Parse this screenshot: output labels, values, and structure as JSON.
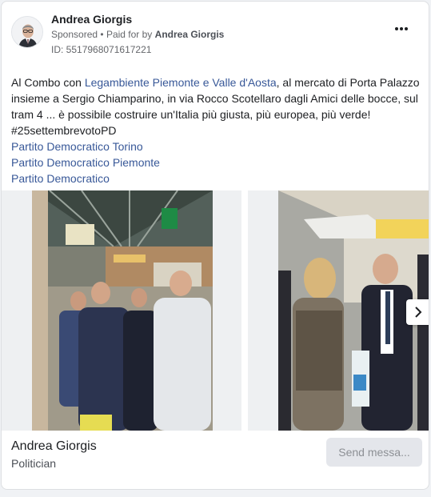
{
  "ad": {
    "advertiser_name": "Andrea Giorgis",
    "sponsored_label": "Sponsored",
    "paid_for_prefix": "Paid for by",
    "paid_for_by": "Andrea Giorgis",
    "separator": "•",
    "library_id": "ID: 5517968071617221",
    "more_options_icon": "more-horizontal-icon"
  },
  "body": {
    "intro": "Al Combo con ",
    "link_legambiente": "Legambiente Piemonte e Valle d'Aosta",
    "text_continued": ", al mercato di Porta Palazzo insieme a Sergio Chiamparino, in via Rocco Scotellaro dagli Amici delle bocce, sul tram 4 ... è possibile costruire un'Italia più giusta, più europea, più verde!",
    "hashtag": "#25settembrevotoPD",
    "tagged_pages": [
      "Partito Democratico Torino",
      "Partito Democratico Piemonte",
      "Partito Democratico"
    ]
  },
  "carousel": {
    "next_icon": "chevron-right-icon",
    "slides": [
      {
        "content": "market-hall-photo"
      },
      {
        "content": "street-market-photo"
      }
    ]
  },
  "footer": {
    "page_name": "Andrea Giorgis",
    "page_category": "Politician",
    "cta_label": "Send messa..."
  },
  "colors": {
    "link": "#385898",
    "text": "#1c1e21",
    "secondary_text": "#65676b",
    "cta_bg": "#e4e6eb",
    "cta_text": "#8d9095"
  }
}
